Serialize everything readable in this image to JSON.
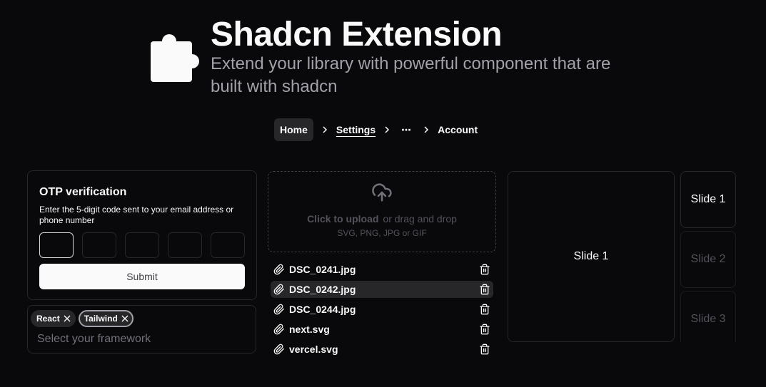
{
  "hero": {
    "icon": "puzzle-icon",
    "title": "Shadcn Extension",
    "subtitle": "Extend your library with powerful component that are built with shadcn"
  },
  "breadcrumb": {
    "items": [
      "Home",
      "Settings",
      "⋯",
      "Account"
    ],
    "separator_icon": "chevron-right-icon"
  },
  "otp": {
    "title": "OTP verification",
    "description": "Enter the 5-digit code sent to your email address or phone number",
    "slots": [
      "",
      "",
      "",
      "",
      ""
    ],
    "active_slot": 0,
    "submit_label": "Submit"
  },
  "tags_input": {
    "tags": [
      "React",
      "Tailwind"
    ],
    "focused_tag": "Tailwind",
    "placeholder": "Select your framework"
  },
  "upload": {
    "icon": "cloud-upload-icon",
    "cta_bold": "Click to upload",
    "cta_rest": "or drag and drop",
    "hint": "SVG, PNG, JPG or GIF"
  },
  "files": [
    {
      "name": "DSC_0241.jpg"
    },
    {
      "name": "DSC_0242.jpg",
      "hovered": true
    },
    {
      "name": "DSC_0244.jpg"
    },
    {
      "name": "next.svg"
    },
    {
      "name": "vercel.svg"
    }
  ],
  "carousel": {
    "main_label": "Slide 1",
    "thumbnails": [
      "Slide 1",
      "Slide 2",
      "Slide 3"
    ],
    "active_index": 0
  },
  "colors": {
    "background": "#09090b",
    "foreground": "#fafafa",
    "muted": "#a1a1aa",
    "border": "#27272a"
  }
}
